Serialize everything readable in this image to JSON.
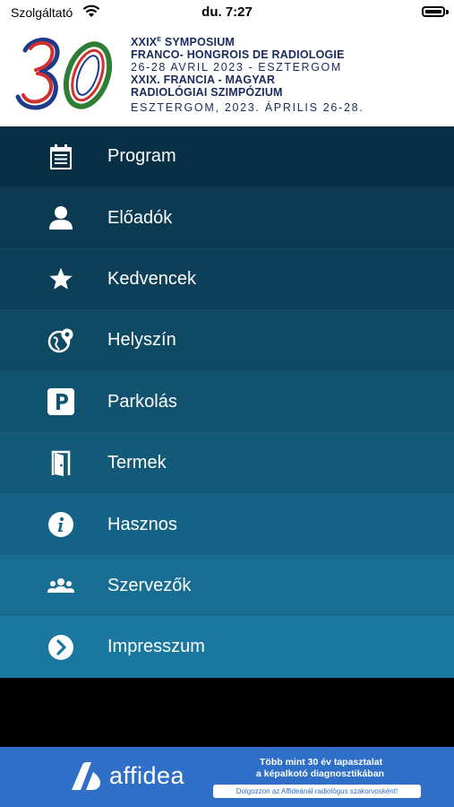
{
  "status_bar": {
    "carrier": "Szolgáltató",
    "time": "du. 7:27"
  },
  "header": {
    "line1_a": "XXIX",
    "line1_sup": "E",
    "line1_b": " SYMPOSIUM",
    "line2": "FRANCO- HONGROIS DE RADIOLOGIE",
    "line3": "26-28 AVRIL 2023 - ESZTERGOM",
    "line4": "XXIX. FRANCIA - MAGYAR",
    "line5": "RADIOLÓGIAI SZIMPÓZIUM",
    "line6": "ESZTERGOM, 2023. ÁPRILIS 26-28."
  },
  "menu": {
    "items": [
      {
        "label": "Program",
        "icon": "calendar-icon",
        "bg": "#082f45"
      },
      {
        "label": "Előadók",
        "icon": "user-icon",
        "bg": "#0b3a52"
      },
      {
        "label": "Kedvencek",
        "icon": "star-icon",
        "bg": "#0d4058"
      },
      {
        "label": "Helyszín",
        "icon": "globe-location-icon",
        "bg": "#0f4a64"
      },
      {
        "label": "Parkolás",
        "icon": "parking-icon",
        "bg": "#11526f"
      },
      {
        "label": "Termek",
        "icon": "door-icon",
        "bg": "#125a78"
      },
      {
        "label": "Hasznos",
        "icon": "info-icon",
        "bg": "#156487"
      },
      {
        "label": "Szervezők",
        "icon": "group-icon",
        "bg": "#176d92"
      },
      {
        "label": "Impresszum",
        "icon": "chevron-right-circle-icon",
        "bg": "#1a779f"
      }
    ]
  },
  "banner": {
    "brand": "affidea",
    "tagline1": "Több mint 30 év tapasztalat",
    "tagline2": "a képalkotó diagnosztikában",
    "cta": "Dolgozzon az Affideánál radiológus szakorvosként!"
  }
}
